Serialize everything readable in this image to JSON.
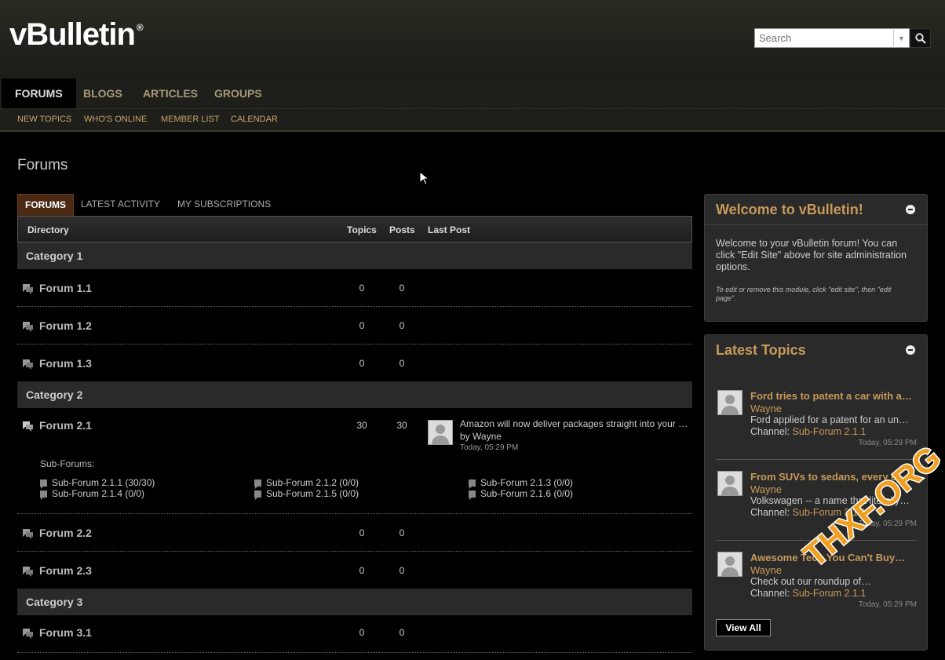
{
  "header": {
    "logo_text": "vBulletin",
    "logo_mark": "®",
    "search_placeholder": "Search"
  },
  "nav": {
    "tabs": [
      {
        "label": "FORUMS",
        "active": true
      },
      {
        "label": "BLOGS"
      },
      {
        "label": "ARTICLES"
      },
      {
        "label": "GROUPS"
      }
    ],
    "subnav": [
      {
        "label": "NEW TOPICS"
      },
      {
        "label": "WHO'S ONLINE"
      },
      {
        "label": "MEMBER LIST"
      },
      {
        "label": "CALENDAR"
      }
    ]
  },
  "page": {
    "title": "Forums"
  },
  "content_tabs": [
    {
      "label": "FORUMS",
      "active": true
    },
    {
      "label": "LATEST ACTIVITY"
    },
    {
      "label": "MY SUBSCRIPTIONS"
    }
  ],
  "table": {
    "headers": {
      "directory": "Directory",
      "topics": "Topics",
      "posts": "Posts",
      "last_post": "Last Post"
    },
    "categories": [
      {
        "name": "Category 1",
        "forums": [
          {
            "name": "Forum 1.1",
            "topics": "0",
            "posts": "0"
          },
          {
            "name": "Forum 1.2",
            "topics": "0",
            "posts": "0"
          },
          {
            "name": "Forum 1.3",
            "topics": "0",
            "posts": "0"
          }
        ]
      },
      {
        "name": "Category 2",
        "forums": [
          {
            "name": "Forum 2.1",
            "topics": "30",
            "posts": "30",
            "last_post": {
              "title": "Amazon will now deliver packages straight into your …",
              "by": "by Wayne",
              "time": "Today, 05:29 PM"
            },
            "subforums_label": "Sub-Forums:",
            "subforums": [
              "Sub-Forum 2.1.1 (30/30)",
              "Sub-Forum 2.1.2 (0/0)",
              "Sub-Forum 2.1.3 (0/0)",
              "Sub-Forum 2.1.4 (0/0)",
              "Sub-Forum 2.1.5 (0/0)",
              "Sub-Forum 2.1.6 (0/0)"
            ]
          },
          {
            "name": "Forum 2.2",
            "topics": "0",
            "posts": "0"
          },
          {
            "name": "Forum 2.3",
            "topics": "0",
            "posts": "0"
          }
        ]
      },
      {
        "name": "Category 3",
        "forums": [
          {
            "name": "Forum 3.1",
            "topics": "0",
            "posts": "0"
          }
        ]
      }
    ]
  },
  "welcome": {
    "title": "Welcome to vBulletin!",
    "text_lines": [
      "Welcome to your vBulletin forum! You can",
      "click \"Edit Site\" above for site administration",
      "options."
    ],
    "small_lines": [
      "To edit or remove this module, click \"edit site\", then \"edit",
      "page\"."
    ]
  },
  "latest_topics": {
    "title": "Latest Topics",
    "items": [
      {
        "title": "Ford tries to patent a car with a…",
        "author": "Wayne",
        "snippet": "Ford applied for a patent for an un…",
        "channel_label": "Channel:",
        "channel": "Sub-Forum 2.1.1",
        "time": "Today, 05:29 PM"
      },
      {
        "title": "From SUVs to sedans, every ele…",
        "author": "Wayne",
        "snippet": "Volkswagen -- a name that literally…",
        "channel_label": "Channel:",
        "channel": "Sub-Forum 2.1.1",
        "time": "Today, 05:29 PM"
      },
      {
        "title": "Awesome Tech You Can't Buy…",
        "author": "Wayne",
        "snippet": "Check out our roundup of…",
        "channel_label": "Channel:",
        "channel": "Sub-Forum 2.1.1",
        "time": "Today, 05:29 PM"
      }
    ],
    "view_all": "View All"
  },
  "watermark": "THXF.ORG",
  "colors": {
    "accent": "#c89a5a",
    "active_tab": "#4a2a14",
    "background": "#000000"
  }
}
